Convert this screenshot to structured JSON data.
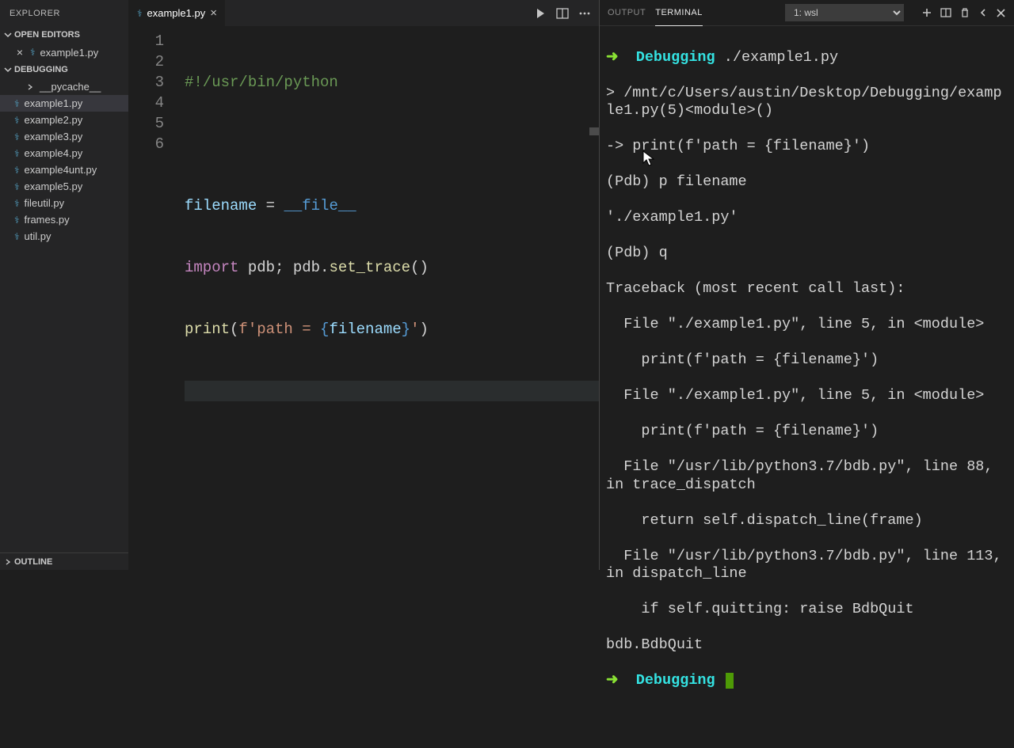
{
  "sidebar": {
    "title": "EXPLORER",
    "openEditors": {
      "header": "OPEN EDITORS",
      "items": [
        "example1.py"
      ]
    },
    "project": {
      "header": "DEBUGGING",
      "items": [
        {
          "label": "__pycache__",
          "folder": true
        },
        {
          "label": "example1.py",
          "selected": true
        },
        {
          "label": "example2.py"
        },
        {
          "label": "example3.py"
        },
        {
          "label": "example4.py"
        },
        {
          "label": "example4unt.py"
        },
        {
          "label": "example5.py"
        },
        {
          "label": "fileutil.py"
        },
        {
          "label": "frames.py"
        },
        {
          "label": "util.py"
        }
      ]
    },
    "outline": "OUTLINE"
  },
  "tabs": {
    "items": [
      {
        "label": "example1.py"
      }
    ]
  },
  "editor": {
    "lines": [
      "1",
      "2",
      "3",
      "4",
      "5",
      "6"
    ],
    "code": {
      "l1": "#!/usr/bin/python",
      "l3a": "filename",
      "l3b": " = ",
      "l3c": "__file__",
      "l4a": "import",
      "l4b": " pdb; pdb.",
      "l4c": "set_trace",
      "l4d": "()",
      "l5a": "print",
      "l5b": "(",
      "l5c": "f'path = ",
      "l5d": "{",
      "l5e": "filename",
      "l5f": "}",
      "l5g": "'",
      "l5h": ")"
    }
  },
  "terminal": {
    "tabs": [
      "OUTPUT",
      "TERMINAL"
    ],
    "active": 1,
    "selector": "1: wsl",
    "prompt_cwd": "Debugging",
    "cmd1": "./example1.py",
    "lines": [
      "> /mnt/c/Users/austin/Desktop/Debugging/example1.py(5)<module>()",
      "-> print(f'path = {filename}')",
      "(Pdb) p filename",
      "'./example1.py'",
      "(Pdb) q",
      "Traceback (most recent call last):",
      "  File \"./example1.py\", line 5, in <module>",
      "    print(f'path = {filename}')",
      "  File \"./example1.py\", line 5, in <module>",
      "    print(f'path = {filename}')",
      "  File \"/usr/lib/python3.7/bdb.py\", line 88, in trace_dispatch",
      "    return self.dispatch_line(frame)",
      "  File \"/usr/lib/python3.7/bdb.py\", line 113, in dispatch_line",
      "    if self.quitting: raise BdbQuit",
      "bdb.BdbQuit"
    ]
  }
}
